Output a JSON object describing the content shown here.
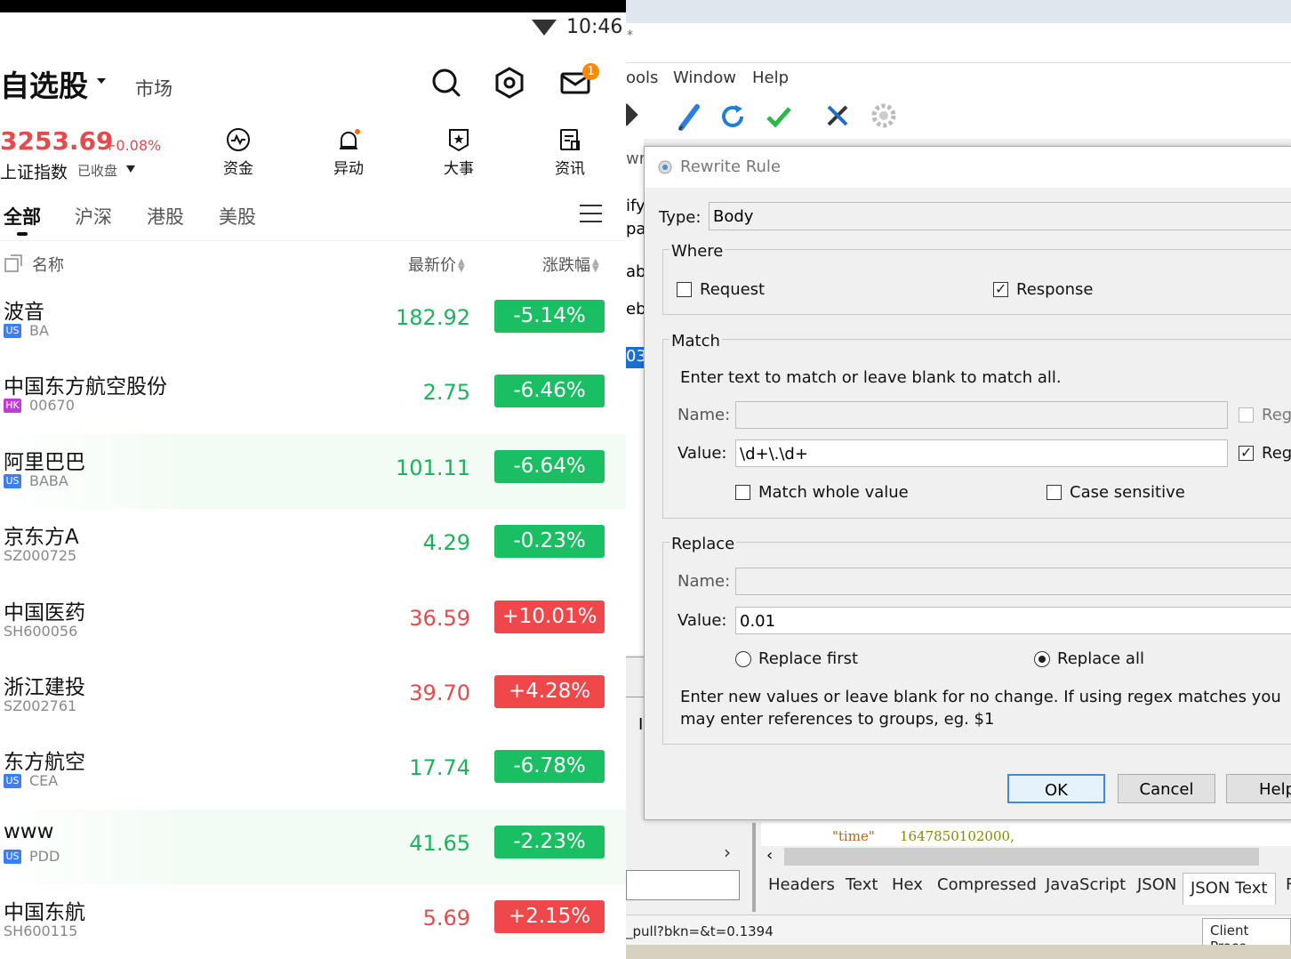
{
  "phone": {
    "time": "10:46",
    "mail_badge": "1",
    "title": "自选股",
    "market_tab": "市场",
    "index": {
      "value": "3253.69",
      "change": "+0.08%",
      "name": "上证指数",
      "status": "已收盘"
    },
    "quick_buttons": [
      {
        "label": "资金",
        "icon": "fund-flow-icon"
      },
      {
        "label": "异动",
        "icon": "alert-bell-icon"
      },
      {
        "label": "大事",
        "icon": "events-shield-icon"
      },
      {
        "label": "资讯",
        "icon": "news-icon"
      }
    ],
    "tabs": [
      "全部",
      "沪深",
      "港股",
      "美股"
    ],
    "columns": {
      "name": "名称",
      "price": "最新价",
      "change": "涨跌幅"
    },
    "stocks": [
      {
        "name": "波音",
        "market": "US",
        "code": "BA",
        "price": "182.92",
        "change": "-5.14%",
        "dir": "down"
      },
      {
        "name": "中国东方航空股份",
        "market": "HK",
        "code": "00670",
        "price": "2.75",
        "change": "-6.46%",
        "dir": "down"
      },
      {
        "name": "阿里巴巴",
        "market": "US",
        "code": "BABA",
        "price": "101.11",
        "change": "-6.64%",
        "dir": "down"
      },
      {
        "name": "京东方A",
        "market": "",
        "code": "SZ000725",
        "price": "4.29",
        "change": "-0.23%",
        "dir": "down"
      },
      {
        "name": "中国医药",
        "market": "",
        "code": "SH600056",
        "price": "36.59",
        "change": "+10.01%",
        "dir": "up"
      },
      {
        "name": "浙江建投",
        "market": "",
        "code": "SZ002761",
        "price": "39.70",
        "change": "+4.28%",
        "dir": "up"
      },
      {
        "name": "东方航空",
        "market": "US",
        "code": "CEA",
        "price": "17.74",
        "change": "-6.78%",
        "dir": "down"
      },
      {
        "name": "www",
        "market": "US",
        "code": "PDD",
        "price": "41.65",
        "change": "-2.23%",
        "dir": "down"
      },
      {
        "name": "中国东航",
        "market": "",
        "code": "SH600115",
        "price": "5.69",
        "change": "+2.15%",
        "dir": "up"
      }
    ]
  },
  "desktop": {
    "menu": [
      "ools",
      "Window",
      "Help"
    ],
    "side_fragments": [
      "wr",
      "ify",
      "pa",
      "ab",
      "ebu",
      "03",
      "I"
    ],
    "json_line": {
      "key": "\"time\"",
      "value": "1647850102000,"
    },
    "inspector_tabs": [
      "Headers",
      "Text",
      "Hex",
      "Compressed",
      "JavaScript",
      "JSON",
      "JSON Text",
      "F"
    ],
    "status_url": "_pull?bkn=&t=0.1394",
    "status_right": "Client Proce",
    "dialog": {
      "title": "Rewrite Rule",
      "type_label": "Type:",
      "type_value": "Body",
      "where": {
        "title": "Where",
        "request": "Request",
        "response": "Response"
      },
      "match": {
        "title": "Match",
        "hint": "Enter text to match or leave blank to match all.",
        "name_label": "Name:",
        "value_label": "Value:",
        "value": "\\d+\\.\\d+",
        "regex_label": "Reg",
        "whole": "Match whole value",
        "case": "Case sensitive"
      },
      "replace": {
        "title": "Replace",
        "name_label": "Name:",
        "value_label": "Value:",
        "value": "0.01",
        "first": "Replace first",
        "all": "Replace all",
        "hint": "Enter new values or leave blank for no change. If using regex matches you may enter references to groups, eg. $1"
      },
      "buttons": {
        "ok": "OK",
        "cancel": "Cancel",
        "help": "Help"
      }
    }
  }
}
